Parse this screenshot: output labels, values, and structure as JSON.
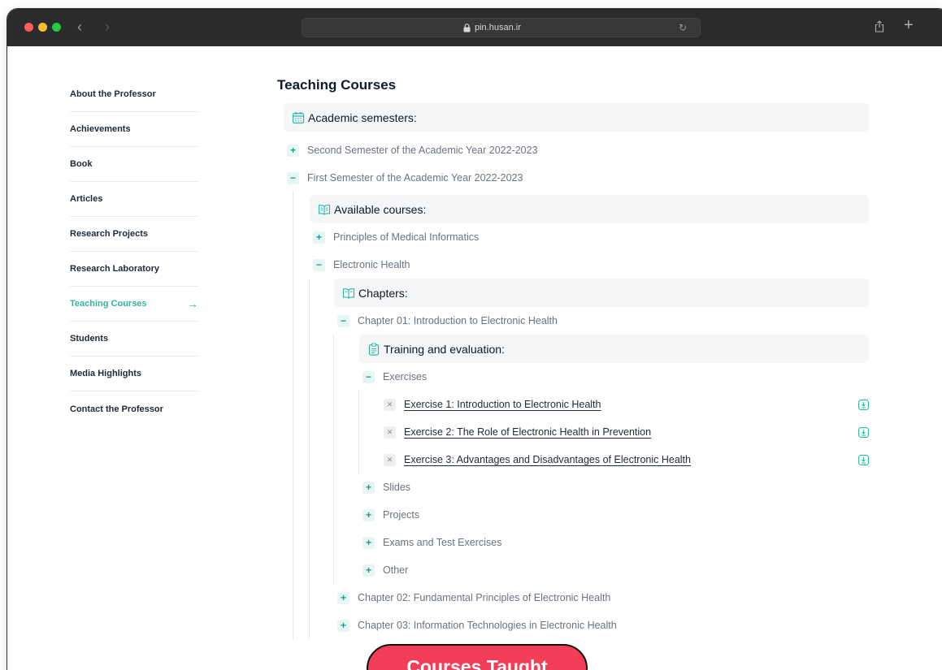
{
  "browser": {
    "url": "pin.husan.ir"
  },
  "sidebar": {
    "items": [
      {
        "label": "About the Professor"
      },
      {
        "label": "Achievements"
      },
      {
        "label": "Book"
      },
      {
        "label": "Articles"
      },
      {
        "label": "Research Projects"
      },
      {
        "label": "Research Laboratory"
      },
      {
        "label": "Teaching Courses",
        "active": true
      },
      {
        "label": "Students"
      },
      {
        "label": "Media Highlights"
      },
      {
        "label": "Contact the Professor"
      }
    ],
    "active_arrow": "→"
  },
  "main": {
    "title": "Teaching Courses",
    "semesters_heading": "Academic semesters:",
    "semester_2": "Second Semester of the Academic Year 2022-2023",
    "semester_1": "First Semester of the Academic Year 2022-2023",
    "courses_heading": "Available courses:",
    "course_1": "Principles of Medical Informatics",
    "course_2": "Electronic Health",
    "chapters_heading": "Chapters:",
    "chapter_1": "Chapter 01: Introduction to Electronic Health",
    "training_heading": "Training and evaluation:",
    "exercises_label": "Exercises",
    "exercises": [
      "Exercise 1: Introduction to Electronic Health",
      "Exercise 2: The Role of Electronic Health in Prevention",
      "Exercise 3: Advantages and Disadvantages of Electronic Health"
    ],
    "slides_label": "Slides",
    "projects_label": "Projects",
    "exams_label": "Exams and Test Exercises",
    "other_label": "Other",
    "chapter_2": "Chapter 02: Fundamental Principles of Electronic Health",
    "chapter_3": "Chapter 03: Information Technologies in Electronic Health"
  },
  "floating_button": "Courses Taught",
  "colors": {
    "accent": "#2bb8a3",
    "pill": "#f43d57",
    "toolbar": "#2b2b2d"
  }
}
